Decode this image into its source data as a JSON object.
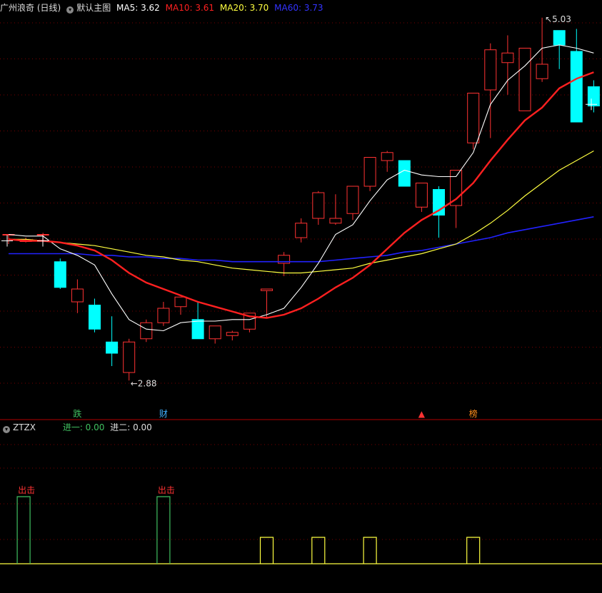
{
  "main_header": {
    "title": "广州浪奇 (日线)",
    "indicator_name": "默认主图",
    "ma5_label": "MA5: 3.62",
    "ma10_label": "MA10: 3.61",
    "ma20_label": "MA20: 3.70",
    "ma60_label": "MA60: 3.73"
  },
  "sub_header": {
    "name": "ZTZX",
    "jin1_label": "进一: 0.00",
    "jin2_label": "进二: 0.00"
  },
  "colors": {
    "up": "#ff3232",
    "down": "#00ffff",
    "ma5": "#ffffff",
    "ma10": "#ff2020",
    "ma20": "#ffff40",
    "ma60": "#2222ff",
    "grid": "#7a0000",
    "signal": "#ffff40",
    "chuji": "#40c060"
  },
  "chart_data": {
    "type": "candlestick",
    "price_range": [
      2.65,
      5.17
    ],
    "max_label": "5.03",
    "min_label": "2.88",
    "ohlc": [
      [
        3.79,
        3.79,
        3.73,
        3.79
      ],
      [
        3.75,
        3.77,
        3.74,
        3.75
      ],
      [
        3.79,
        3.8,
        3.74,
        3.79
      ],
      [
        3.62,
        3.64,
        3.45,
        3.46
      ],
      [
        3.37,
        3.51,
        3.3,
        3.45
      ],
      [
        3.35,
        3.39,
        3.18,
        3.2
      ],
      [
        3.12,
        3.28,
        2.97,
        3.05
      ],
      [
        2.93,
        3.14,
        2.88,
        3.12
      ],
      [
        3.14,
        3.26,
        3.12,
        3.24
      ],
      [
        3.24,
        3.37,
        3.22,
        3.33
      ],
      [
        3.34,
        3.35,
        3.29,
        3.4
      ],
      [
        3.26,
        3.37,
        3.22,
        3.14
      ],
      [
        3.14,
        3.22,
        3.11,
        3.22
      ],
      [
        3.16,
        3.19,
        3.13,
        3.18
      ],
      [
        3.2,
        3.3,
        3.18,
        3.3
      ],
      [
        3.44,
        3.44,
        3.27,
        3.45
      ],
      [
        3.61,
        3.68,
        3.53,
        3.66
      ],
      [
        3.77,
        3.89,
        3.74,
        3.86
      ],
      [
        3.89,
        4.06,
        3.85,
        4.05
      ],
      [
        3.86,
        4.04,
        3.85,
        3.89
      ],
      [
        3.92,
        4.09,
        3.88,
        4.09
      ],
      [
        4.09,
        4.27,
        4.06,
        4.27
      ],
      [
        4.25,
        4.31,
        4.18,
        4.3
      ],
      [
        4.25,
        4.25,
        4.17,
        4.09
      ],
      [
        3.96,
        4.08,
        3.93,
        4.11
      ],
      [
        4.07,
        4.09,
        3.77,
        3.91
      ],
      [
        3.97,
        4.19,
        3.83,
        4.19
      ],
      [
        4.36,
        4.62,
        4.32,
        4.67
      ],
      [
        4.69,
        4.98,
        4.39,
        4.94
      ],
      [
        4.86,
        5.03,
        4.66,
        4.92
      ],
      [
        4.56,
        4.85,
        4.56,
        4.95
      ],
      [
        4.76,
        5.14,
        4.74,
        4.85
      ],
      [
        5.06,
        5.04,
        4.82,
        4.97
      ],
      [
        4.93,
        5.07,
        4.54,
        4.49
      ],
      [
        4.71,
        4.75,
        4.55,
        4.59
      ]
    ],
    "ma5": [
      3.79,
      3.78,
      3.78,
      3.7,
      3.66,
      3.6,
      3.42,
      3.26,
      3.2,
      3.19,
      3.24,
      3.25,
      3.25,
      3.26,
      3.26,
      3.29,
      3.33,
      3.46,
      3.61,
      3.79,
      3.85,
      4.0,
      4.13,
      4.19,
      4.16,
      4.15,
      4.15,
      4.3,
      4.6,
      4.75,
      4.84,
      4.95,
      4.97,
      4.95,
      4.92
    ],
    "ma10": [
      3.76,
      3.75,
      3.75,
      3.74,
      3.72,
      3.69,
      3.63,
      3.55,
      3.49,
      3.45,
      3.41,
      3.37,
      3.34,
      3.31,
      3.28,
      3.27,
      3.29,
      3.33,
      3.39,
      3.46,
      3.52,
      3.6,
      3.7,
      3.8,
      3.88,
      3.94,
      4.01,
      4.11,
      4.25,
      4.38,
      4.5,
      4.58,
      4.7,
      4.76,
      4.8
    ],
    "ma20": [
      3.76,
      3.76,
      3.75,
      3.74,
      3.73,
      3.72,
      3.7,
      3.68,
      3.66,
      3.65,
      3.63,
      3.62,
      3.6,
      3.58,
      3.57,
      3.56,
      3.55,
      3.55,
      3.56,
      3.57,
      3.58,
      3.61,
      3.63,
      3.65,
      3.67,
      3.7,
      3.73,
      3.79,
      3.86,
      3.94,
      4.03,
      4.11,
      4.19,
      4.25,
      4.31
    ],
    "ma60": [
      3.67,
      3.67,
      3.67,
      3.67,
      3.67,
      3.66,
      3.66,
      3.65,
      3.65,
      3.64,
      3.64,
      3.63,
      3.63,
      3.62,
      3.62,
      3.62,
      3.62,
      3.62,
      3.62,
      3.63,
      3.64,
      3.65,
      3.66,
      3.68,
      3.69,
      3.71,
      3.73,
      3.75,
      3.77,
      3.8,
      3.82,
      3.84,
      3.86,
      3.88,
      3.9
    ],
    "markers": [
      {
        "index": 4,
        "text": "跌",
        "color": "#40c060"
      },
      {
        "index": 9,
        "text": "财",
        "color": "#40b0ff"
      },
      {
        "index": 24,
        "text": "▲",
        "color": "#ff3232"
      },
      {
        "index": 27,
        "text": "榜",
        "color": "#ff8c1a"
      }
    ],
    "signals": [
      0,
      0,
      0,
      0,
      0,
      0,
      0,
      0,
      0,
      0,
      0,
      0,
      0,
      0,
      0,
      1,
      0,
      0,
      1,
      0,
      0,
      1,
      0,
      0,
      0,
      0,
      0,
      1,
      0,
      0,
      0,
      0,
      0,
      0,
      0
    ],
    "chuji": [
      {
        "index": 1,
        "text": "出击"
      },
      {
        "index": 9,
        "text": "出击"
      }
    ]
  }
}
